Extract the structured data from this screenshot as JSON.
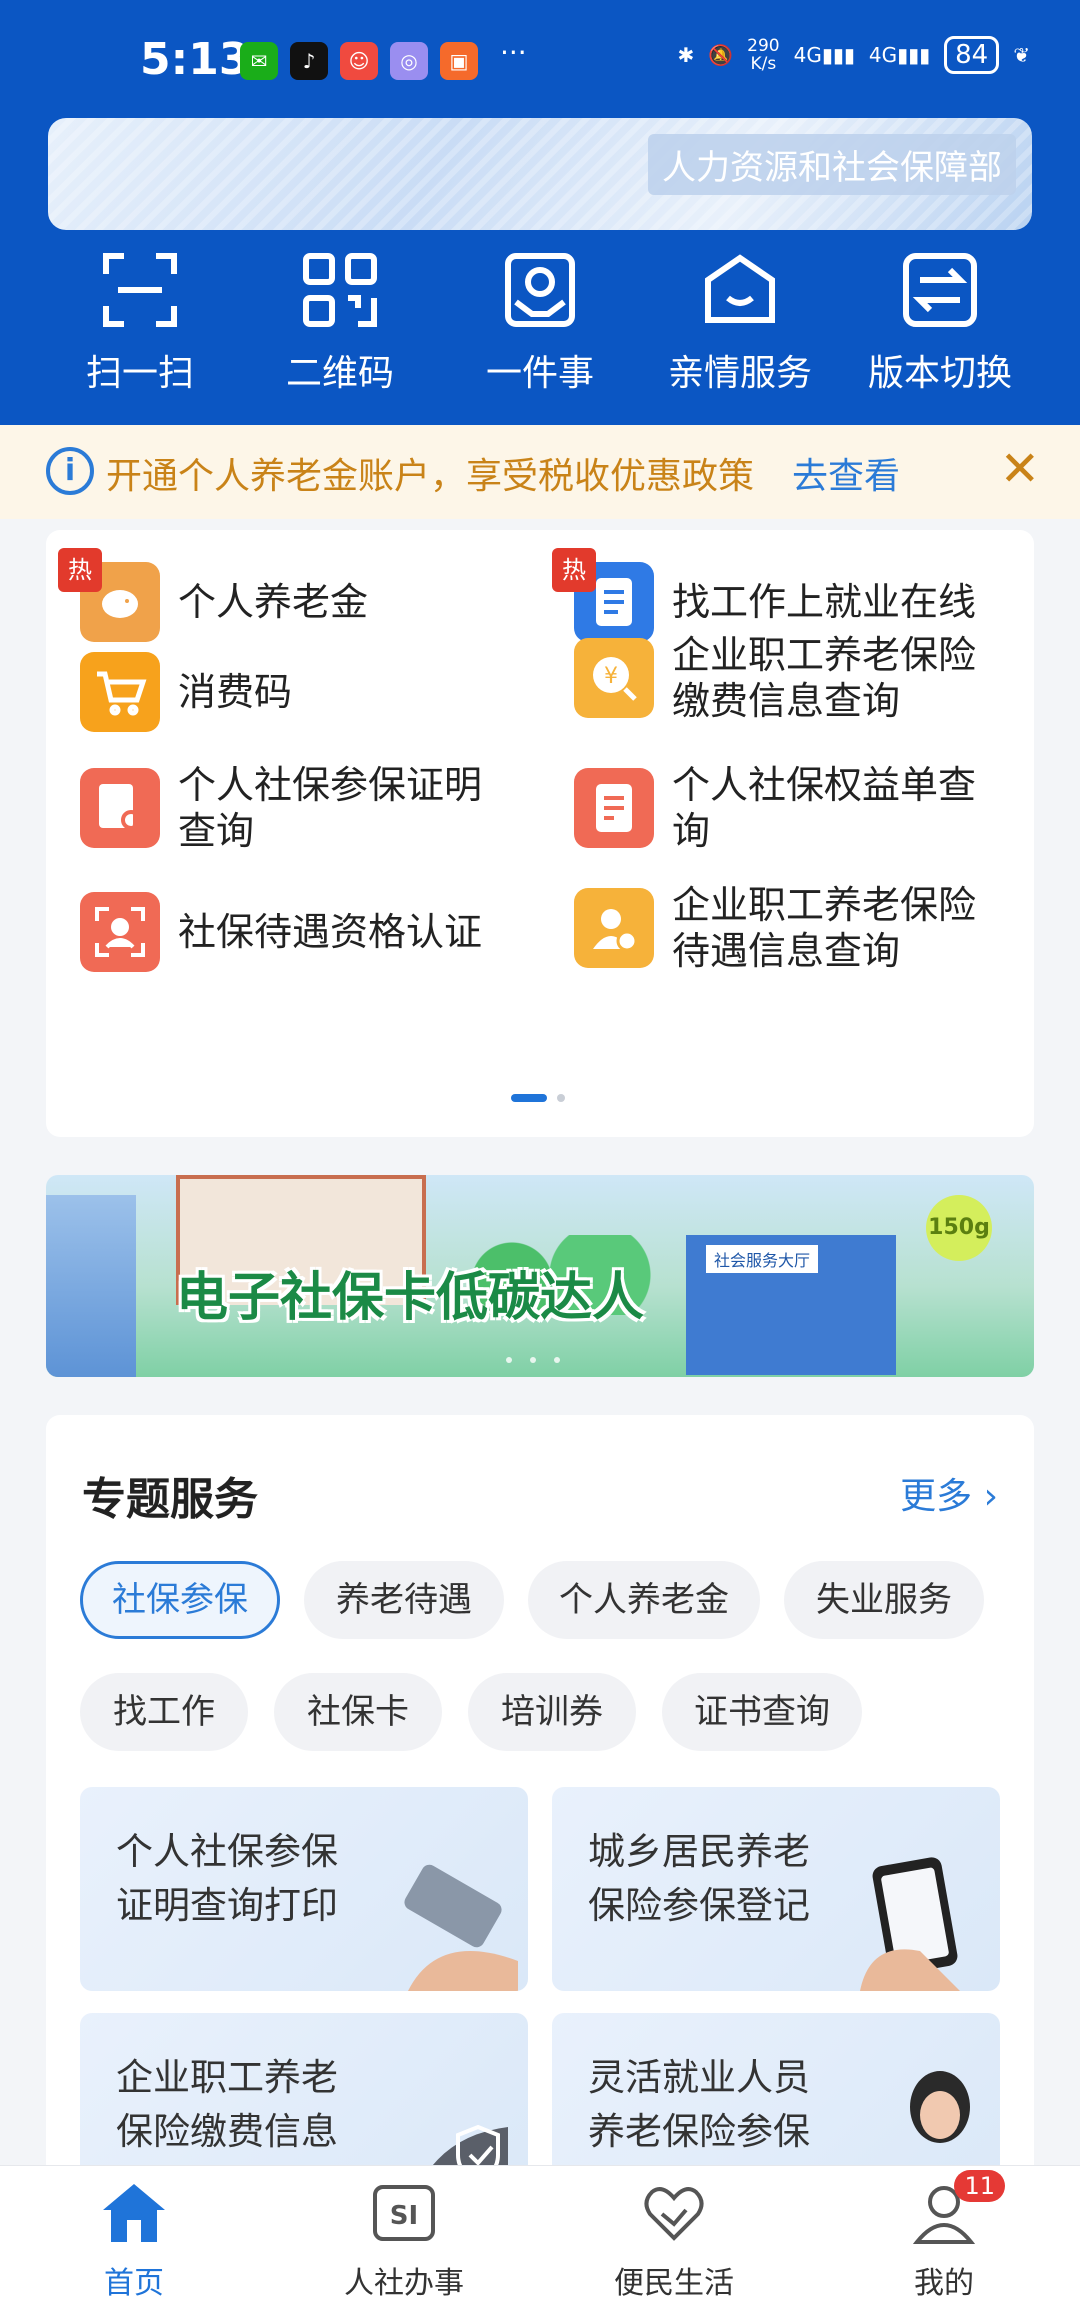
{
  "status": {
    "time": "5:13",
    "speed_top": "290",
    "speed_unit": "K/s",
    "net1": "4G",
    "net2": "4G",
    "battery": "84",
    "more": "···"
  },
  "header": {
    "banner_text": "人力资源和社会保障部",
    "quick": [
      {
        "label": "扫一扫",
        "icon": "scan-icon"
      },
      {
        "label": "二维码",
        "icon": "qrcode-icon"
      },
      {
        "label": "一件事",
        "icon": "one-thing-icon"
      },
      {
        "label": "亲情服务",
        "icon": "family-icon"
      },
      {
        "label": "版本切换",
        "icon": "switch-icon"
      }
    ]
  },
  "notice": {
    "text": "开通个人养老金账户，享受税收优惠政策",
    "link": "去查看"
  },
  "grid": {
    "hot_label": "热",
    "items": [
      {
        "label": "个人养老金",
        "icon": "piggy-bank-icon",
        "color": "#f0a24a",
        "hot": true
      },
      {
        "label": "找工作上就业在线",
        "icon": "document-icon",
        "color": "#2f7ae5",
        "hot": true
      },
      {
        "label": "消费码",
        "icon": "cart-icon",
        "color": "#f7a21c",
        "hot": false
      },
      {
        "label": "企业职工养老保险缴费信息查询",
        "icon": "yuan-search-icon",
        "color": "#f6b23a",
        "hot": false
      },
      {
        "label": "个人社保参保证明查询",
        "icon": "certificate-search-icon",
        "color": "#f06a55",
        "hot": false
      },
      {
        "label": "个人社保权益单查询",
        "icon": "form-icon",
        "color": "#f06a55",
        "hot": false
      },
      {
        "label": "社保待遇资格认证",
        "icon": "face-scan-icon",
        "color": "#f06a55",
        "hot": false
      },
      {
        "label": "企业职工养老保险待遇信息查询",
        "icon": "user-badge-icon",
        "color": "#f6b23a",
        "hot": false
      }
    ]
  },
  "promo": {
    "title": "电子社保卡低碳达人",
    "badge": "150g",
    "sign": "社会服务大厅"
  },
  "special": {
    "title": "专题服务",
    "more": "更多",
    "chips": [
      "社保参保",
      "养老待遇",
      "个人养老金",
      "失业服务",
      "找工作",
      "社保卡",
      "培训券",
      "证书查询"
    ],
    "cards": [
      {
        "label": "个人社保参保证明查询打印"
      },
      {
        "label": "城乡居民养老保险参保登记"
      },
      {
        "label": "企业职工养老保险缴费信息查询"
      },
      {
        "label": "灵活就业人员养老保险参保登记"
      }
    ]
  },
  "bottom_nav": {
    "items": [
      {
        "label": "首页",
        "icon": "home-icon",
        "active": true
      },
      {
        "label": "人社办事",
        "icon": "si-icon",
        "active": false
      },
      {
        "label": "便民生活",
        "icon": "heart-hands-icon",
        "active": false
      },
      {
        "label": "我的",
        "icon": "profile-icon",
        "active": false
      }
    ],
    "badge": "11"
  },
  "colors": {
    "brand": "#0b56c3",
    "accent": "#2b7bd7",
    "notice_text": "#c98318"
  }
}
